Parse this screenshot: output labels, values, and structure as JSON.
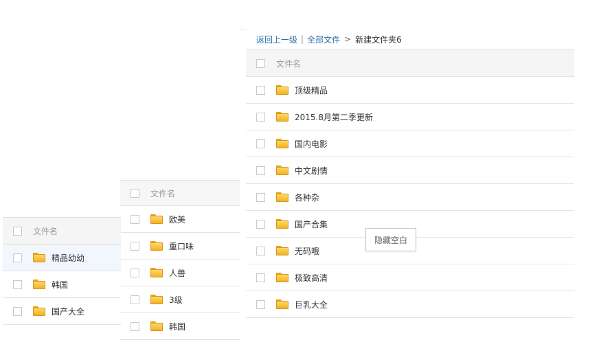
{
  "panel_a": {
    "header_label": "文件名",
    "items": [
      {
        "label": "精品幼幼",
        "highlighted": true
      },
      {
        "label": "韩国",
        "highlighted": false
      },
      {
        "label": "国产大全",
        "highlighted": false
      }
    ]
  },
  "panel_b": {
    "header_label": "文件名",
    "items": [
      {
        "label": "欧美"
      },
      {
        "label": "重口味"
      },
      {
        "label": "人兽"
      },
      {
        "label": "3级"
      },
      {
        "label": "韩国"
      }
    ]
  },
  "panel_c": {
    "breadcrumb": {
      "back": "返回上一级",
      "separator": "|",
      "all_files": "全部文件",
      "arrow": ">",
      "current": "新建文件夹6"
    },
    "header_label": "文件名",
    "items": [
      {
        "label": "顶级精品"
      },
      {
        "label": "2015.8月第二季更新"
      },
      {
        "label": "国内电影"
      },
      {
        "label": "中文剧情"
      },
      {
        "label": "各种杂"
      },
      {
        "label": "国产合集"
      },
      {
        "label": "无码哦"
      },
      {
        "label": "极致高清"
      },
      {
        "label": "巨乳大全"
      }
    ]
  },
  "hide_blank_button": "隐藏空白",
  "colors": {
    "link": "#2d6fa8",
    "header_bg": "#f5f5f5",
    "row_highlight": "#f1f7fd",
    "folder": "#f2b227"
  }
}
